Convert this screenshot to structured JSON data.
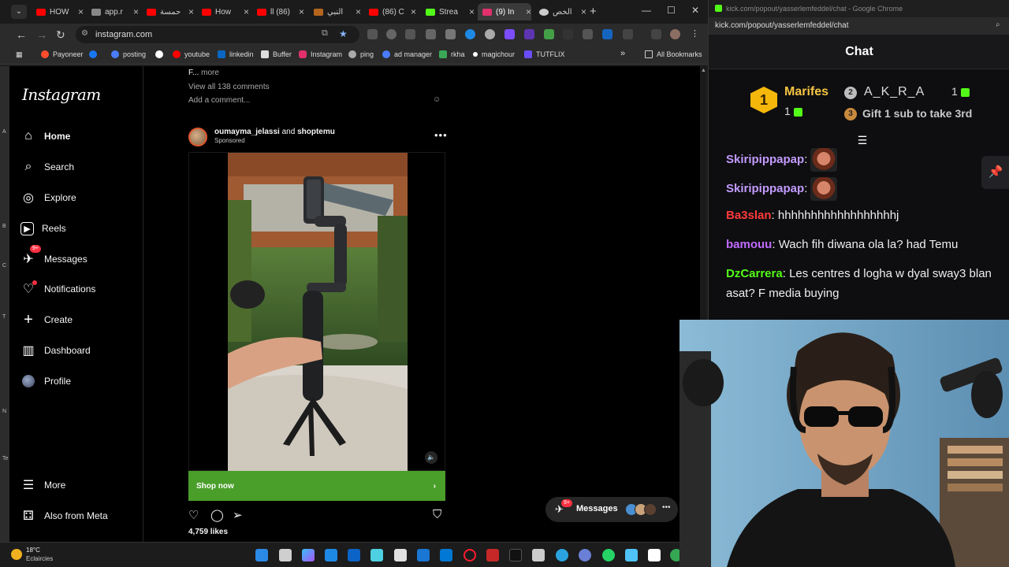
{
  "browser": {
    "tabs": [
      {
        "label": "HOW",
        "color": "#ff0000"
      },
      {
        "label": "app.r",
        "color": "#888888"
      },
      {
        "label": "حمسة",
        "color": "#ff0000"
      },
      {
        "label": "How",
        "color": "#ff0000"
      },
      {
        "label": "ll (86)",
        "color": "#ff0000"
      },
      {
        "label": "النبي",
        "color": "#b5651d"
      },
      {
        "label": "(86) C",
        "color": "#ff0000"
      },
      {
        "label": "Strea",
        "color": "#53fc18"
      },
      {
        "label": "(9) In",
        "color": "#e1306c"
      },
      {
        "label": "الخص",
        "color": "#cccccc"
      }
    ],
    "url": "instagram.com",
    "bookmarks": [
      {
        "label": "Payoneer",
        "color": "#ff4d2e"
      },
      {
        "label": "",
        "color": "#1877f2"
      },
      {
        "label": "posting",
        "color": "#4a7cff"
      },
      {
        "label": "",
        "color": "#ffffff"
      },
      {
        "label": "youtube",
        "color": "#ff0000"
      },
      {
        "label": "linkedin",
        "color": "#0a66c2"
      },
      {
        "label": "Buffer",
        "color": "#dddddd"
      },
      {
        "label": "Instagram",
        "color": "#e1306c"
      },
      {
        "label": "ping",
        "color": "#aaaaaa"
      },
      {
        "label": "ad manager",
        "color": "#4a7cff"
      },
      {
        "label": "rkha",
        "color": "#3aa757"
      },
      {
        "label": "magichour",
        "color": "#ffffff"
      },
      {
        "label": "TUTFLIX",
        "color": "#6a4cff"
      }
    ],
    "all_bookmarks": "All Bookmarks",
    "overflow": "»"
  },
  "instagram": {
    "logo": "Instagram",
    "nav": [
      {
        "label": "Home",
        "icon": "⌂"
      },
      {
        "label": "Search",
        "icon": "⌕"
      },
      {
        "label": "Explore",
        "icon": "◎"
      },
      {
        "label": "Reels",
        "icon": "▶"
      },
      {
        "label": "Messages",
        "icon": "✈"
      },
      {
        "label": "Notifications",
        "icon": "♡"
      },
      {
        "label": "Create",
        "icon": "+"
      },
      {
        "label": "Dashboard",
        "icon": "▥"
      },
      {
        "label": "Profile",
        "icon": "●"
      }
    ],
    "messages_badge": "9+",
    "more_label": "More",
    "meta_label": "Also from Meta",
    "prev_post": {
      "more_prefix": "F...",
      "more_link": "more",
      "view_comments": "View all 138 comments",
      "add_comment": "Add a comment..."
    },
    "post": {
      "author": "oumayma_jelassi",
      "and": "and",
      "coauthor": "shoptemu",
      "sponsored": "Sponsored",
      "cta": "Shop now",
      "likes": "4,759 likes"
    },
    "messages_pill": {
      "label": "Messages",
      "badge": "9+"
    }
  },
  "taskbar": {
    "temp": "18°C",
    "desc": "Eclaircies"
  },
  "chat": {
    "window_title": "kick.com/popout/yasserlemfeddel/chat - Google Chrome",
    "url": "kick.com/popout/yasserlemfeddel/chat",
    "header": "Chat",
    "gifters": {
      "rank1": {
        "medal": "1",
        "name": "Marifes",
        "count": "1"
      },
      "rank2": {
        "medal": "2",
        "name": "A_K_R_A",
        "count": "1"
      },
      "rank3": {
        "medal": "3",
        "text": "Gift 1 sub to take 3rd"
      }
    },
    "messages": [
      {
        "user": "Skiripippapap",
        "color": "#c39bff",
        "text": ""
      },
      {
        "user": "Skiripippapap",
        "color": "#c39bff",
        "text": ""
      },
      {
        "user": "Ba3slan",
        "color": "#ff3b3b",
        "text": "hhhhhhhhhhhhhhhhhhj"
      },
      {
        "user": "bamouu",
        "color": "#c06bff",
        "text": "Wach fih diwana ola la? had Temu"
      },
      {
        "user": "DzCarrera",
        "color": "#53fc18",
        "text": "Les centres d logha w dyal sway3 blan asat? F media buying"
      }
    ]
  }
}
